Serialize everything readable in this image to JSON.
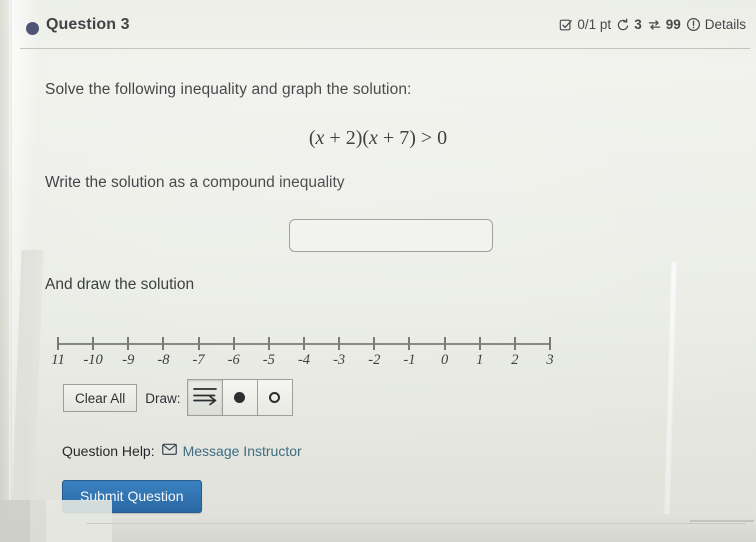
{
  "header": {
    "question_label": "Question 3",
    "dot_color": "#343a5e",
    "points": "0/1 pt",
    "attempts_icon": "rotate-left-icon",
    "attempts": "3",
    "reattempts_icon": "repeat-icon",
    "reattempts": "99",
    "info_icon": "info-circle-icon",
    "details_label": "Details",
    "score_icon": "check-square-icon"
  },
  "question": {
    "prompt_1": "Solve the following inequality and graph the solution:",
    "expression_plain": "(x + 2)(x + 7) > 0",
    "expression_parts": {
      "open1": "(",
      "var1": "x",
      "op1": " + 2)(",
      "var2": "x",
      "op2": " + 7) > 0"
    },
    "prompt_2": "Write the solution as a compound inequality",
    "prompt_3": "And draw the solution"
  },
  "answer_input": {
    "value": "",
    "placeholder": ""
  },
  "number_line": {
    "min": -11,
    "max": 3,
    "step": 1,
    "tick_labels": [
      "11",
      "-10",
      "-9",
      "-8",
      "-7",
      "-6",
      "-5",
      "-4",
      "-3",
      "-2",
      "-1",
      "0",
      "1",
      "2",
      "3"
    ],
    "tick_values": [
      -11,
      -10,
      -9,
      -8,
      -7,
      -6,
      -5,
      -4,
      -3,
      -2,
      -1,
      0,
      1,
      2,
      3
    ],
    "plotted_points": [],
    "plotted_rays": []
  },
  "toolbar": {
    "clear_all_label": "Clear All",
    "draw_label": "Draw:",
    "tools": [
      {
        "name": "ray-tool",
        "icon": "ray-arrow-icon",
        "selected": true
      },
      {
        "name": "closed-point-tool",
        "icon": "filled-circle-icon",
        "selected": false
      },
      {
        "name": "open-point-tool",
        "icon": "open-circle-icon",
        "selected": false
      }
    ]
  },
  "footer": {
    "question_help_label": "Question Help:",
    "message_instructor_label": "Message Instructor",
    "message_icon": "envelope-icon",
    "message_link_color": "#37697f",
    "submit_label": "Submit Question",
    "submit_color": "#2a6aa8"
  }
}
